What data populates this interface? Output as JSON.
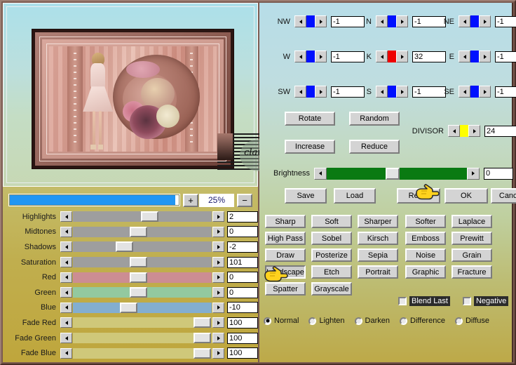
{
  "preview": {
    "zoom_percent": "25%",
    "zoom_plus": "+",
    "zoom_minus": "−",
    "watermark": "claudia"
  },
  "sliders": [
    {
      "label": "Highlights",
      "value": "2",
      "pos": 55,
      "track": "gray"
    },
    {
      "label": "Midtones",
      "value": "0",
      "pos": 47,
      "track": "gray"
    },
    {
      "label": "Shadows",
      "value": "-2",
      "pos": 37,
      "track": "gray"
    },
    {
      "label": "Saturation",
      "value": "101",
      "pos": 47,
      "track": "gray"
    },
    {
      "label": "Red",
      "value": "0",
      "pos": 47,
      "track": "red"
    },
    {
      "label": "Green",
      "value": "0",
      "pos": 47,
      "track": "green"
    },
    {
      "label": "Blue",
      "value": "-10",
      "pos": 40,
      "track": "blue"
    },
    {
      "label": "Fade Red",
      "value": "100",
      "pos": 93,
      "track": "gold"
    },
    {
      "label": "Fade Green",
      "value": "100",
      "pos": 93,
      "track": "gold"
    },
    {
      "label": "Fade Blue",
      "value": "100",
      "pos": 93,
      "track": "gold"
    }
  ],
  "compass": [
    {
      "label": "NW",
      "value": "-1",
      "bar": "blue"
    },
    {
      "label": "N",
      "value": "-1",
      "bar": "blue"
    },
    {
      "label": "NE",
      "value": "-1",
      "bar": "blue"
    },
    {
      "label": "W",
      "value": "-1",
      "bar": "blue"
    },
    {
      "label": "K",
      "value": "32",
      "bar": "red"
    },
    {
      "label": "E",
      "value": "-1",
      "bar": "blue"
    },
    {
      "label": "SW",
      "value": "-1",
      "bar": "blue"
    },
    {
      "label": "S",
      "value": "-1",
      "bar": "blue"
    },
    {
      "label": "SE",
      "value": "-1",
      "bar": "blue"
    }
  ],
  "mid_buttons": [
    "Rotate",
    "Random",
    "Increase",
    "Reduce"
  ],
  "divisor": {
    "label": "DIVISOR",
    "value": "24"
  },
  "brightness": {
    "label": "Brightness",
    "value": "0"
  },
  "actions": [
    "Save",
    "Load",
    "Reset",
    "OK",
    "Cancel"
  ],
  "filters": [
    "Sharp",
    "Soft",
    "Sharper",
    "Softer",
    "Laplace",
    "High Pass",
    "Sobel",
    "Kirsch",
    "Emboss",
    "Prewitt",
    "Draw",
    "Posterize",
    "Sepia",
    "Noise",
    "Grain",
    "Landscape",
    "Etch",
    "Portrait",
    "Graphic",
    "Fracture",
    "Spatter",
    "Grayscale"
  ],
  "selected_filter": "Landscape",
  "checkboxes": [
    {
      "label": "Blend Last",
      "checked": false
    },
    {
      "label": "Negative",
      "checked": false
    }
  ],
  "blend_modes": [
    {
      "label": "Normal",
      "selected": true
    },
    {
      "label": "Lighten",
      "selected": false
    },
    {
      "label": "Darken",
      "selected": false
    },
    {
      "label": "Difference",
      "selected": false
    },
    {
      "label": "Diffuse",
      "selected": false
    }
  ],
  "colors": {
    "zoom_fill": "#2196f3",
    "brightness_track": "#0a7a12",
    "spin_blue": "#0010ff",
    "spin_red": "#ee0000",
    "spin_yellow": "#ffff00"
  }
}
